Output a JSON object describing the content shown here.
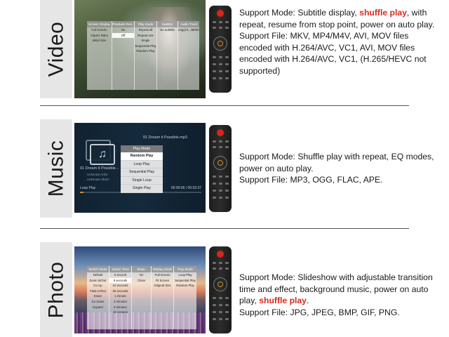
{
  "sections": {
    "video": {
      "label": "Video",
      "menu": {
        "columns": [
          {
            "header": "Screen Display",
            "items": [
              "Full Screen",
              "Aspect Ratio",
              "Initial Size"
            ]
          },
          {
            "header": "Playback Res...",
            "items": [
              "On",
              "Off"
            ]
          },
          {
            "header": "Play mode",
            "items": [
              "Repeat all",
              "Repeat one",
              "Single",
              "Sequential Play",
              "Random Play"
            ]
          },
          {
            "header": "Subtitle",
            "items": [
              "No subtitle"
            ]
          },
          {
            "header": "Audio Track",
            "items": [
              "eng(1/1 ,48000,2"
            ]
          }
        ]
      },
      "desc": {
        "mode_pre": "Support Mode: Subtitle display, ",
        "mode_hl": "shuffle play",
        "mode_post": ", with repeat, resume from stop point, power on auto play.",
        "file": "Support File: MKV, MP4/M4V, AVI, MOV files encoded with H.264/AVC, VC1, AVI, MOV files encoded with H.264/AVC, VC1, (H.265/HEVC not supported)"
      }
    },
    "music": {
      "label": "Music",
      "track_top": "01 Dream it Possible.mp3",
      "track_top2": "...",
      "title": "01 Dream it Possible...",
      "artist": "Unknown Artist",
      "album": "Unknown Album",
      "loop": "Loop Play",
      "time": "00:00:06 / 00:03:37",
      "progress": 0.03,
      "menu": {
        "header": "Play Mode",
        "items": [
          "Random Play",
          "Loop Play",
          "Sequential Play",
          "Single Loop",
          "Single Play"
        ]
      },
      "desc": {
        "mode": "Support Mode: Shuffle play with repeat, EQ modes, power on auto play.",
        "file": "Support File: MP3, OGG, FLAC, APE."
      }
    },
    "photo": {
      "label": "Photo",
      "menu": {
        "columns": [
          {
            "header": "Switch Mode",
            "items": [
              "Default",
              "Zoom In/Out",
              "Go Up",
              "Fade In/Out",
              "Erase",
              "Go Down",
              "Expand"
            ]
          },
          {
            "header": "Switch Time",
            "items": [
              "0 second",
              "5 seconds",
              "10 seconds",
              "30 seconds",
              "1 minute",
              "3 minutes",
              "5 minutes",
              "15 minutes"
            ]
          },
          {
            "header": "Music",
            "items": [
              "On",
              "Close"
            ]
          },
          {
            "header": "Display Mode",
            "items": [
              "Full Screen",
              "Fit Screen",
              "Original Size"
            ]
          },
          {
            "header": "Play Mode",
            "items": [
              "Loop Play",
              "Sequential Play",
              "Random Play"
            ]
          }
        ]
      },
      "desc": {
        "mode_pre": "Support Mode: Slideshow with adjustable transition time and effect, background music, power on auto play, ",
        "mode_hl": "shuffle play",
        "mode_post": ".",
        "file": "Support File: JPG, JPEG, BMP, GIF, PNG."
      }
    }
  },
  "colors": {
    "highlight": "#d62a1e",
    "label_bar": "#e6e6e6"
  }
}
